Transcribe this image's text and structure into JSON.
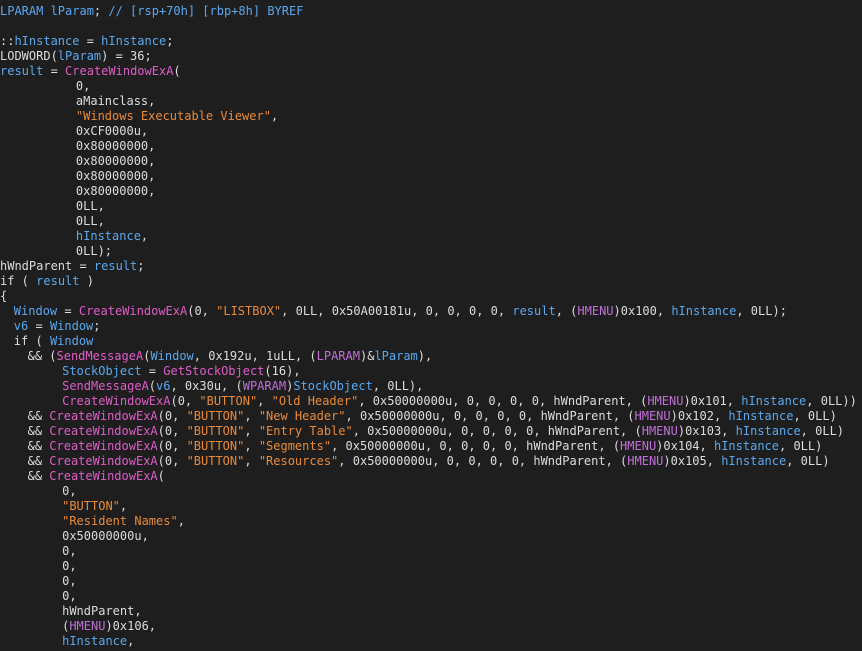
{
  "editor": {
    "lines": [
      {
        "indent": 0,
        "tokens": [
          [
            "v",
            "LPARAM lParam"
          ],
          [
            "p",
            "; "
          ],
          [
            "c",
            "// [rsp+70h] [rbp+8h] BYREF"
          ]
        ]
      },
      {
        "indent": 0,
        "tokens": []
      },
      {
        "indent": 0,
        "tokens": [
          [
            "p",
            "::"
          ],
          [
            "v",
            "hInstance"
          ],
          [
            "p",
            " = "
          ],
          [
            "v",
            "hInstance"
          ],
          [
            "p",
            ";"
          ]
        ]
      },
      {
        "indent": 0,
        "tokens": [
          [
            "p",
            "LODWORD("
          ],
          [
            "v",
            "lParam"
          ],
          [
            "p",
            ") = 36;"
          ]
        ]
      },
      {
        "indent": 0,
        "tokens": [
          [
            "v",
            "result"
          ],
          [
            "p",
            " = "
          ],
          [
            "f",
            "CreateWindowExA"
          ],
          [
            "p",
            "("
          ]
        ]
      },
      {
        "indent": 11,
        "tokens": [
          [
            "p",
            "0,"
          ]
        ]
      },
      {
        "indent": 11,
        "tokens": [
          [
            "p",
            "aMainclass,"
          ]
        ]
      },
      {
        "indent": 11,
        "tokens": [
          [
            "s",
            "\"Windows Executable Viewer\""
          ],
          [
            "p",
            ","
          ]
        ]
      },
      {
        "indent": 11,
        "tokens": [
          [
            "p",
            "0xCF0000u,"
          ]
        ]
      },
      {
        "indent": 11,
        "tokens": [
          [
            "p",
            "0x80000000,"
          ]
        ]
      },
      {
        "indent": 11,
        "tokens": [
          [
            "p",
            "0x80000000,"
          ]
        ]
      },
      {
        "indent": 11,
        "tokens": [
          [
            "p",
            "0x80000000,"
          ]
        ]
      },
      {
        "indent": 11,
        "tokens": [
          [
            "p",
            "0x80000000,"
          ]
        ]
      },
      {
        "indent": 11,
        "tokens": [
          [
            "p",
            "0LL,"
          ]
        ]
      },
      {
        "indent": 11,
        "tokens": [
          [
            "p",
            "0LL,"
          ]
        ]
      },
      {
        "indent": 11,
        "tokens": [
          [
            "v",
            "hInstance"
          ],
          [
            "p",
            ","
          ]
        ]
      },
      {
        "indent": 11,
        "tokens": [
          [
            "p",
            "0LL);"
          ]
        ]
      },
      {
        "indent": 0,
        "tokens": [
          [
            "p",
            "hWndParent = "
          ],
          [
            "v",
            "result"
          ],
          [
            "p",
            ";"
          ]
        ]
      },
      {
        "indent": 0,
        "tokens": [
          [
            "k",
            "if"
          ],
          [
            "p",
            " ( "
          ],
          [
            "v",
            "result"
          ],
          [
            "p",
            " )"
          ]
        ]
      },
      {
        "indent": 0,
        "tokens": [
          [
            "p",
            "{"
          ]
        ]
      },
      {
        "indent": 2,
        "tokens": [
          [
            "v",
            "Window"
          ],
          [
            "p",
            " = "
          ],
          [
            "f",
            "CreateWindowExA"
          ],
          [
            "p",
            "(0, "
          ],
          [
            "s",
            "\"LISTBOX\""
          ],
          [
            "p",
            ", 0LL, 0x50A00181u, 0, 0, 0, 0, "
          ],
          [
            "v",
            "result"
          ],
          [
            "p",
            ", ("
          ],
          [
            "h",
            "HMENU"
          ],
          [
            "p",
            ")0x100, "
          ],
          [
            "v",
            "hInstance"
          ],
          [
            "p",
            ", 0LL);"
          ]
        ]
      },
      {
        "indent": 2,
        "tokens": [
          [
            "v",
            "v6"
          ],
          [
            "p",
            " = "
          ],
          [
            "v",
            "Window"
          ],
          [
            "p",
            ";"
          ]
        ]
      },
      {
        "indent": 2,
        "tokens": [
          [
            "k",
            "if"
          ],
          [
            "p",
            " ( "
          ],
          [
            "v",
            "Window"
          ]
        ]
      },
      {
        "indent": 4,
        "tokens": [
          [
            "p",
            "&& ("
          ],
          [
            "f",
            "SendMessageA"
          ],
          [
            "p",
            "("
          ],
          [
            "v",
            "Window"
          ],
          [
            "p",
            ", 0x192u, 1uLL, ("
          ],
          [
            "h",
            "LPARAM"
          ],
          [
            "p",
            ")&"
          ],
          [
            "v",
            "lParam"
          ],
          [
            "p",
            "),"
          ]
        ]
      },
      {
        "indent": 9,
        "tokens": [
          [
            "v",
            "StockObject"
          ],
          [
            "p",
            " = "
          ],
          [
            "f",
            "GetStockObject"
          ],
          [
            "p",
            "(16),"
          ]
        ]
      },
      {
        "indent": 9,
        "tokens": [
          [
            "f",
            "SendMessageA"
          ],
          [
            "p",
            "("
          ],
          [
            "v",
            "v6"
          ],
          [
            "p",
            ", 0x30u, ("
          ],
          [
            "h",
            "WPARAM"
          ],
          [
            "p",
            ")"
          ],
          [
            "v",
            "StockObject"
          ],
          [
            "p",
            ", 0LL),"
          ]
        ]
      },
      {
        "indent": 9,
        "tokens": [
          [
            "f",
            "CreateWindowExA"
          ],
          [
            "p",
            "(0, "
          ],
          [
            "s",
            "\"BUTTON\""
          ],
          [
            "p",
            ", "
          ],
          [
            "s",
            "\"Old Header\""
          ],
          [
            "p",
            ", 0x50000000u, 0, 0, 0, 0, hWndParent, ("
          ],
          [
            "h",
            "HMENU"
          ],
          [
            "p",
            ")0x101, "
          ],
          [
            "v",
            "hInstance"
          ],
          [
            "p",
            ", 0LL))"
          ]
        ]
      },
      {
        "indent": 4,
        "tokens": [
          [
            "p",
            "&& "
          ],
          [
            "f",
            "CreateWindowExA"
          ],
          [
            "p",
            "(0, "
          ],
          [
            "s",
            "\"BUTTON\""
          ],
          [
            "p",
            ", "
          ],
          [
            "s",
            "\"New Header\""
          ],
          [
            "p",
            ", 0x50000000u, 0, 0, 0, 0, hWndParent, ("
          ],
          [
            "h",
            "HMENU"
          ],
          [
            "p",
            ")0x102, "
          ],
          [
            "v",
            "hInstance"
          ],
          [
            "p",
            ", 0LL)"
          ]
        ]
      },
      {
        "indent": 4,
        "tokens": [
          [
            "p",
            "&& "
          ],
          [
            "f",
            "CreateWindowExA"
          ],
          [
            "p",
            "(0, "
          ],
          [
            "s",
            "\"BUTTON\""
          ],
          [
            "p",
            ", "
          ],
          [
            "s",
            "\"Entry Table\""
          ],
          [
            "p",
            ", 0x50000000u, 0, 0, 0, 0, hWndParent, ("
          ],
          [
            "h",
            "HMENU"
          ],
          [
            "p",
            ")0x103, "
          ],
          [
            "v",
            "hInstance"
          ],
          [
            "p",
            ", 0LL)"
          ]
        ]
      },
      {
        "indent": 4,
        "tokens": [
          [
            "p",
            "&& "
          ],
          [
            "f",
            "CreateWindowExA"
          ],
          [
            "p",
            "(0, "
          ],
          [
            "s",
            "\"BUTTON\""
          ],
          [
            "p",
            ", "
          ],
          [
            "s",
            "\"Segments\""
          ],
          [
            "p",
            ", 0x50000000u, 0, 0, 0, 0, hWndParent, ("
          ],
          [
            "h",
            "HMENU"
          ],
          [
            "p",
            ")0x104, "
          ],
          [
            "v",
            "hInstance"
          ],
          [
            "p",
            ", 0LL)"
          ]
        ]
      },
      {
        "indent": 4,
        "tokens": [
          [
            "p",
            "&& "
          ],
          [
            "f",
            "CreateWindowExA"
          ],
          [
            "p",
            "(0, "
          ],
          [
            "s",
            "\"BUTTON\""
          ],
          [
            "p",
            ", "
          ],
          [
            "s",
            "\"Resources\""
          ],
          [
            "p",
            ", 0x50000000u, 0, 0, 0, 0, hWndParent, ("
          ],
          [
            "h",
            "HMENU"
          ],
          [
            "p",
            ")0x105, "
          ],
          [
            "v",
            "hInstance"
          ],
          [
            "p",
            ", 0LL)"
          ]
        ]
      },
      {
        "indent": 4,
        "tokens": [
          [
            "p",
            "&& "
          ],
          [
            "f",
            "CreateWindowExA"
          ],
          [
            "p",
            "("
          ]
        ]
      },
      {
        "indent": 9,
        "tokens": [
          [
            "p",
            "0,"
          ]
        ]
      },
      {
        "indent": 9,
        "tokens": [
          [
            "s",
            "\"BUTTON\""
          ],
          [
            "p",
            ","
          ]
        ]
      },
      {
        "indent": 9,
        "tokens": [
          [
            "s",
            "\"Resident Names\""
          ],
          [
            "p",
            ","
          ]
        ]
      },
      {
        "indent": 9,
        "tokens": [
          [
            "p",
            "0x50000000u,"
          ]
        ]
      },
      {
        "indent": 9,
        "tokens": [
          [
            "p",
            "0,"
          ]
        ]
      },
      {
        "indent": 9,
        "tokens": [
          [
            "p",
            "0,"
          ]
        ]
      },
      {
        "indent": 9,
        "tokens": [
          [
            "p",
            "0,"
          ]
        ]
      },
      {
        "indent": 9,
        "tokens": [
          [
            "p",
            "0,"
          ]
        ]
      },
      {
        "indent": 9,
        "tokens": [
          [
            "p",
            "hWndParent,"
          ]
        ]
      },
      {
        "indent": 9,
        "tokens": [
          [
            "p",
            "("
          ],
          [
            "h",
            "HMENU"
          ],
          [
            "p",
            ")0x106,"
          ]
        ]
      },
      {
        "indent": 9,
        "tokens": [
          [
            "v",
            "hInstance"
          ],
          [
            "p",
            ","
          ]
        ]
      }
    ]
  }
}
